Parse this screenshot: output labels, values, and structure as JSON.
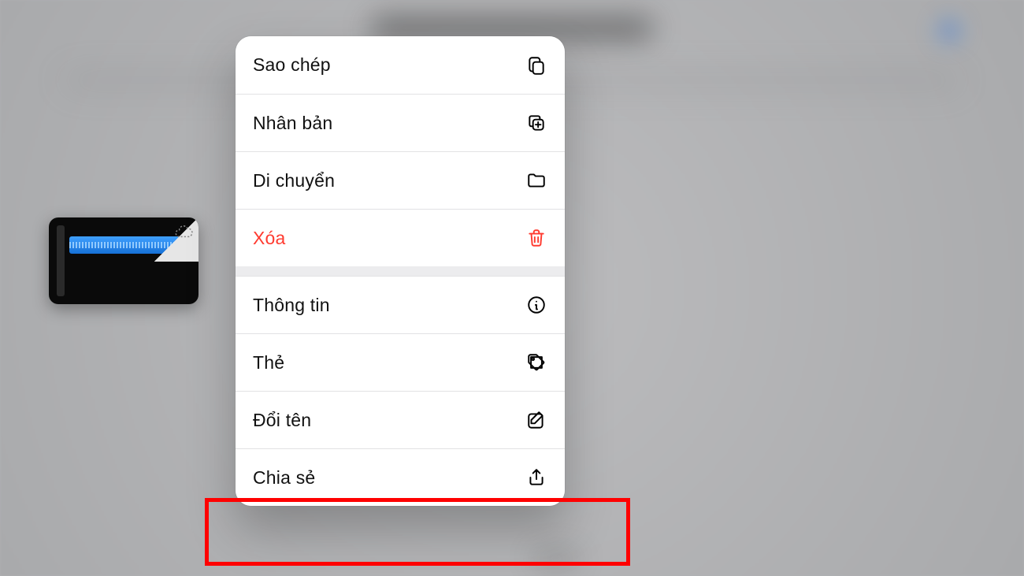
{
  "menu": {
    "copy": {
      "label": "Sao chép"
    },
    "duplicate": {
      "label": "Nhân bản"
    },
    "move": {
      "label": "Di chuyển"
    },
    "delete": {
      "label": "Xóa"
    },
    "info": {
      "label": "Thông tin"
    },
    "tags": {
      "label": "Thẻ"
    },
    "rename": {
      "label": "Đổi tên"
    },
    "share": {
      "label": "Chia sẻ"
    }
  },
  "annotation": {
    "highlight_target": "share-item"
  }
}
